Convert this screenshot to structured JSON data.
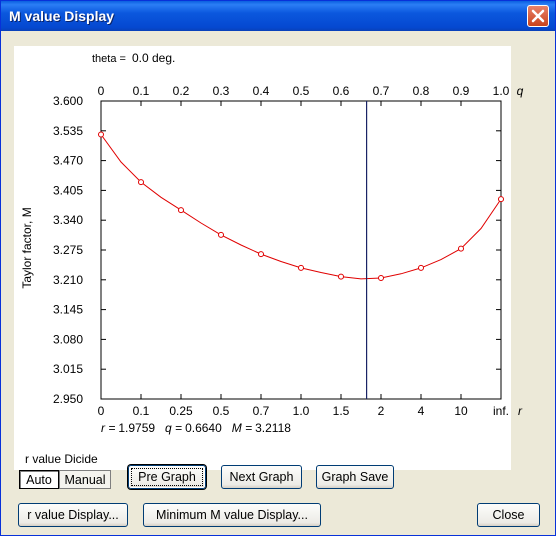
{
  "window": {
    "title": "M value Display"
  },
  "theta": {
    "label": "theta =",
    "value": "0.0 deg."
  },
  "chart_data": {
    "type": "line",
    "ylabel": "Taylor factor, M",
    "ylim": [
      2.95,
      3.6
    ],
    "y_ticks": [
      "3.600",
      "3.535",
      "3.470",
      "3.405",
      "3.340",
      "3.275",
      "3.210",
      "3.145",
      "3.080",
      "3.015",
      "2.950"
    ],
    "top_axis": {
      "ticks": [
        "0",
        "0.1",
        "0.2",
        "0.3",
        "0.4",
        "0.5",
        "0.6",
        "0.7",
        "0.8",
        "0.9",
        "1.0"
      ],
      "label": "q",
      "range": [
        0,
        1
      ]
    },
    "bottom_axis": {
      "ticks": [
        "0",
        "0.1",
        "0.25",
        "0.5",
        "0.7",
        "1.0",
        "1.5",
        "2",
        "4",
        "10",
        "inf."
      ],
      "label": "r"
    },
    "series": [
      {
        "x_q": [
          0,
          0.1,
          0.2,
          0.3,
          0.4,
          0.5,
          0.6,
          0.7,
          0.8,
          0.9,
          1.0
        ],
        "values": [
          3.527,
          3.423,
          3.362,
          3.308,
          3.266,
          3.236,
          3.217,
          3.214,
          3.236,
          3.278,
          3.386
        ],
        "color": "#e00000"
      }
    ],
    "curve": {
      "q": [
        0,
        0.05,
        0.1,
        0.15,
        0.2,
        0.25,
        0.3,
        0.35,
        0.4,
        0.45,
        0.5,
        0.55,
        0.6,
        0.65,
        0.7,
        0.75,
        0.8,
        0.85,
        0.9,
        0.95,
        1.0
      ],
      "M": [
        3.527,
        3.467,
        3.423,
        3.39,
        3.362,
        3.334,
        3.308,
        3.286,
        3.266,
        3.25,
        3.236,
        3.226,
        3.217,
        3.212,
        3.214,
        3.223,
        3.236,
        3.254,
        3.278,
        3.322,
        3.386
      ]
    },
    "marker_q": 0.664,
    "marker_color": "#1a2466",
    "grid": false
  },
  "readout": {
    "r_label": "r =",
    "r_value": "1.9759",
    "q_label": "q =",
    "q_value": "0.6640",
    "M_label": "M =",
    "M_value": "3.2118"
  },
  "controls": {
    "r_value_label": "r value Dicide",
    "auto": "Auto",
    "manual": "Manual",
    "pre_graph": "Pre Graph",
    "next_graph": "Next Graph",
    "graph_save": "Graph Save",
    "r_value_display": "r value Display...",
    "minimum_m_display": "Minimum M value Display...",
    "close": "Close"
  }
}
